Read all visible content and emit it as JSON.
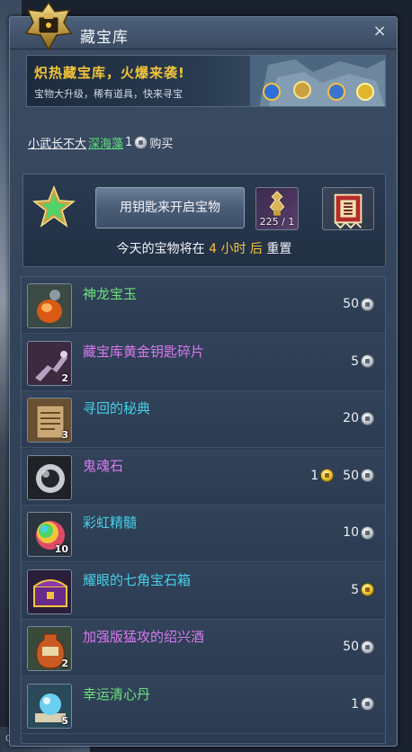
{
  "window": {
    "title": "藏宝库",
    "close_label": "×"
  },
  "banner": {
    "title": "炽热藏宝库，火爆来袭!",
    "subtitle": "宝物大升级，稀有道具，快来寻宝"
  },
  "buyer_line": {
    "name": "小武长不大",
    "item": "深海藻",
    "count": "1",
    "action": "购买"
  },
  "key_panel": {
    "open_button_label": "用钥匙来开启宝物",
    "key_count": "225 / 1",
    "reset_prefix": "今天的宝物将在",
    "reset_hours": "4 小时 后",
    "reset_suffix": "重置"
  },
  "items": [
    {
      "name": "神龙宝玉",
      "name_color": "#6ee07c",
      "qty": "",
      "icon": "orange-gem-icon",
      "price": "50",
      "gold": ""
    },
    {
      "name": "藏宝库黄金钥匙碎片",
      "name_color": "#d879ef",
      "qty": "2",
      "icon": "key-fragment-icon",
      "price": "5",
      "gold": ""
    },
    {
      "name": "寻回的秘典",
      "name_color": "#45cfe8",
      "qty": "3",
      "icon": "scroll-book-icon",
      "price": "20",
      "gold": ""
    },
    {
      "name": "鬼魂石",
      "name_color": "#d879ef",
      "qty": "",
      "icon": "ghost-stone-icon",
      "price": "50",
      "gold": "1"
    },
    {
      "name": "彩虹精髓",
      "name_color": "#45cfe8",
      "qty": "10",
      "icon": "rainbow-essence-icon",
      "price": "10",
      "gold": ""
    },
    {
      "name": "耀眼的七角宝石箱",
      "name_color": "#45cfe8",
      "qty": "",
      "icon": "treasure-chest-icon",
      "price": "5",
      "gold": ""
    },
    {
      "name": "加强版猛攻的绍兴酒",
      "name_color": "#d879ef",
      "qty": "2",
      "icon": "wine-jar-icon",
      "price": "50",
      "gold": ""
    },
    {
      "name": "幸运清心丹",
      "name_color": "#6ee07c",
      "qty": "5",
      "icon": "pill-orb-icon",
      "price": "1",
      "gold": ""
    }
  ],
  "item_6_currency": "gold",
  "background": {
    "bottom_left_text": "0000"
  },
  "colors": {
    "gold": "#f2c43a",
    "green": "#6ee07c",
    "purple": "#d879ef",
    "cyan": "#45cfe8"
  }
}
